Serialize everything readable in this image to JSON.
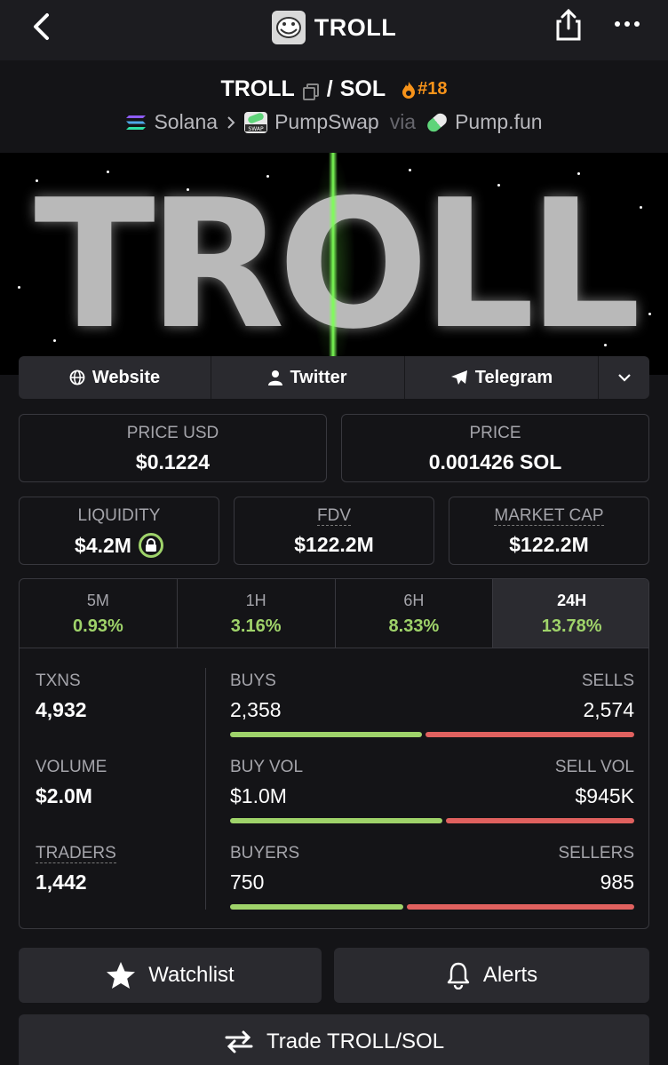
{
  "header": {
    "title": "TROLL",
    "back_icon": "back-arrow-icon",
    "share_icon": "share-icon",
    "more_icon": "more-icon"
  },
  "pair": {
    "base": "TROLL",
    "separator": "/",
    "quote": "SOL",
    "rank": "#18"
  },
  "chain": {
    "network": "Solana",
    "dex": "PumpSwap",
    "via": "via",
    "launchpad": "Pump.fun"
  },
  "banner": {
    "text": "TROLL"
  },
  "socials": {
    "website": "Website",
    "twitter": "Twitter",
    "telegram": "Telegram"
  },
  "prices": {
    "price_usd_label": "PRICE USD",
    "price_usd": "$0.1224",
    "price_label": "PRICE",
    "price": "0.001426 SOL",
    "liquidity_label": "LIQUIDITY",
    "liquidity": "$4.2M",
    "fdv_label": "FDV",
    "fdv": "$122.2M",
    "mcap_label": "MARKET CAP",
    "mcap": "$122.2M"
  },
  "timeframes": [
    {
      "label": "5M",
      "change": "0.93%"
    },
    {
      "label": "1H",
      "change": "3.16%"
    },
    {
      "label": "6H",
      "change": "8.33%"
    },
    {
      "label": "24H",
      "change": "13.78%",
      "active": true
    }
  ],
  "stats": {
    "txns_label": "TXNS",
    "txns": "4,932",
    "volume_label": "VOLUME",
    "volume": "$2.0M",
    "traders_label": "TRADERS",
    "traders": "1,442",
    "buys_label": "BUYS",
    "buys": "2,358",
    "sells_label": "SELLS",
    "sells": "2,574",
    "buyvol_label": "BUY VOL",
    "buyvol": "$1.0M",
    "sellvol_label": "SELL VOL",
    "sellvol": "$945K",
    "buyers_label": "BUYERS",
    "buyers": "750",
    "sellers_label": "SELLERS",
    "sellers": "985",
    "buy_ratio": 0.478,
    "buyvol_ratio": 0.529,
    "buyers_ratio": 0.432
  },
  "actions": {
    "watchlist": "Watchlist",
    "alerts": "Alerts",
    "trade": "Trade TROLL/SOL"
  },
  "colors": {
    "green": "#9fd36a",
    "red": "#e0615f",
    "rank": "#f7931a"
  }
}
